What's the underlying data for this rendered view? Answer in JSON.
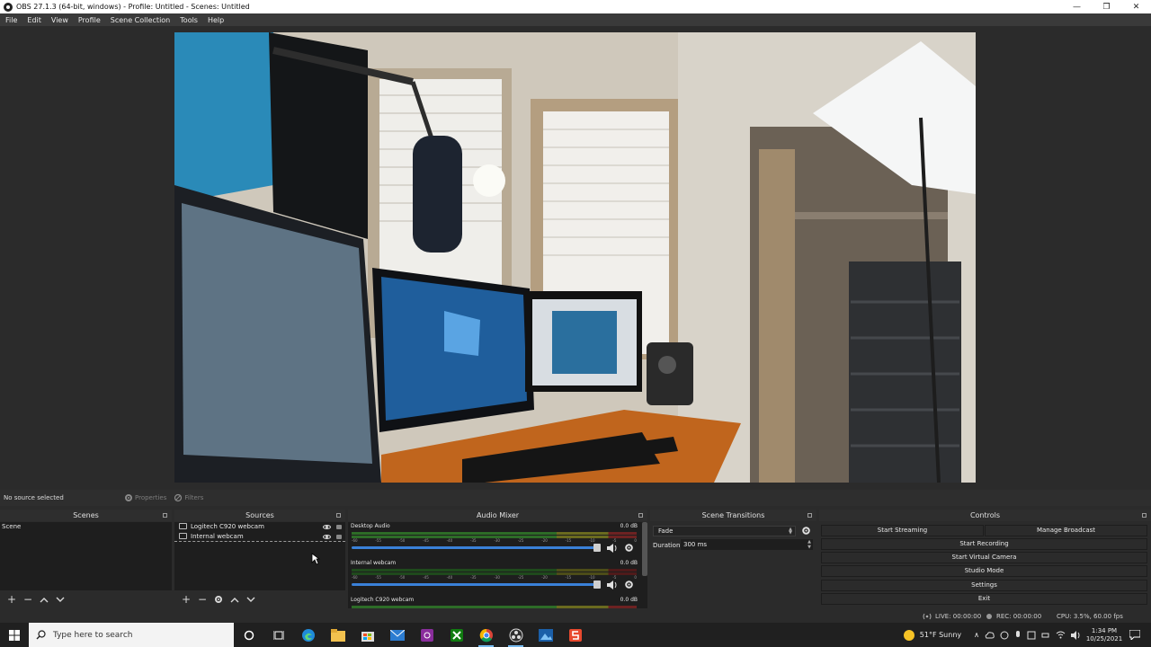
{
  "window": {
    "title": "OBS 27.1.3 (64-bit, windows) - Profile: Untitled - Scenes: Untitled",
    "minimize": "—",
    "maximize": "❐",
    "close": "✕"
  },
  "menu": [
    "File",
    "Edit",
    "View",
    "Profile",
    "Scene Collection",
    "Tools",
    "Help"
  ],
  "context_bar": {
    "status": "No source selected",
    "properties": "Properties",
    "filters": "Filters"
  },
  "docks": {
    "scenes": {
      "title": "Scenes",
      "items": [
        "Scene"
      ]
    },
    "sources": {
      "title": "Sources",
      "items": [
        "Logitech C920 webcam",
        "Internal webcam"
      ]
    },
    "mixer": {
      "title": "Audio Mixer",
      "channels": [
        {
          "name": "Desktop Audio",
          "db": "0.0 dB",
          "volume": 1.0
        },
        {
          "name": "Internal webcam",
          "db": "0.0 dB",
          "volume": 1.0
        },
        {
          "name": "Logitech C920 webcam",
          "db": "0.0 dB",
          "volume": 1.0
        }
      ],
      "ticks": [
        "-60",
        "-55",
        "-50",
        "-45",
        "-40",
        "-35",
        "-30",
        "-25",
        "-20",
        "-15",
        "-10",
        "-5",
        "0"
      ]
    },
    "transitions": {
      "title": "Scene Transitions",
      "selected": "Fade",
      "duration_label": "Duration",
      "duration_value": "300 ms"
    },
    "controls": {
      "title": "Controls",
      "start_streaming": "Start Streaming",
      "manage_broadcast": "Manage Broadcast",
      "start_recording": "Start Recording",
      "start_virtual_camera": "Start Virtual Camera",
      "studio_mode": "Studio Mode",
      "settings": "Settings",
      "exit": "Exit"
    }
  },
  "status": {
    "live": "LIVE: 00:00:00",
    "rec": "REC: 00:00:00",
    "cpu": "CPU: 3.5%, 60.00 fps"
  },
  "taskbar": {
    "search_placeholder": "Type here to search",
    "weather": "51°F  Sunny",
    "time": "1:34 PM",
    "date": "10/25/2021"
  },
  "colors": {
    "accent": "#3a81d8",
    "panel": "#2b2b2b",
    "list_bg": "#1e1e1e"
  }
}
